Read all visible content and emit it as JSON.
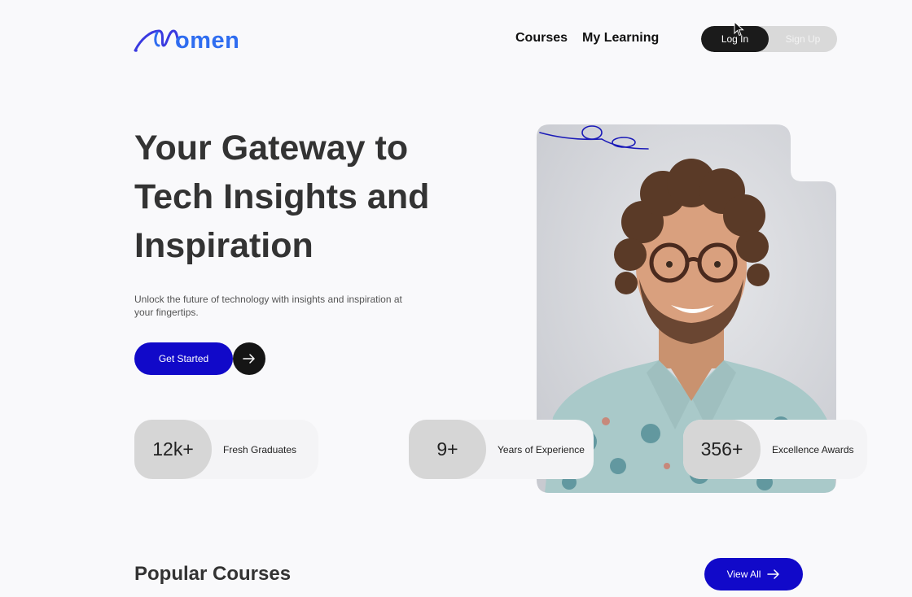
{
  "brand": {
    "name": "omen",
    "color": "#2f6df0"
  },
  "nav": {
    "courses": "Courses",
    "my_learning": "My Learning"
  },
  "auth": {
    "login": "Log In",
    "signup": "Sign Up"
  },
  "hero": {
    "title_line1": "Your Gateway to",
    "title_line2": "Tech Insights and",
    "title_line3": "Inspiration",
    "subtitle": "Unlock the future of technology with insights and inspiration at your fingertips.",
    "cta_label": "Get Started"
  },
  "stats": [
    {
      "value": "12k+",
      "label": "Fresh Graduates"
    },
    {
      "value": "9+",
      "label": "Years of Experience"
    },
    {
      "value": "356+",
      "label": "Excellence Awards"
    }
  ],
  "popular": {
    "title": "Popular Courses",
    "view_all": "View All"
  },
  "colors": {
    "primary": "#1109c9",
    "dark": "#1b1b1b",
    "pill_gray": "#d6d6d6"
  },
  "icons": [
    "logo-swoosh-icon",
    "arrow-right-icon",
    "cursor-icon"
  ]
}
